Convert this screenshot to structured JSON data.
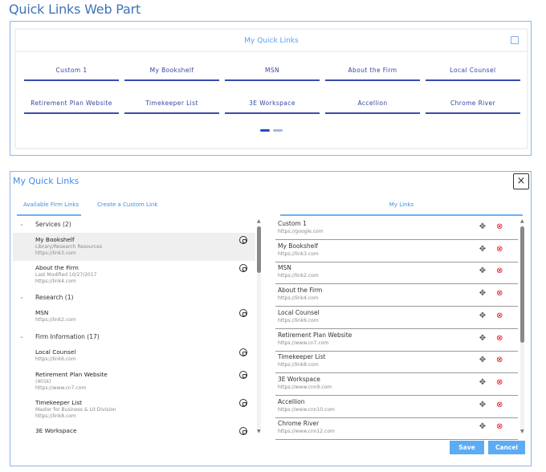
{
  "page_title": "Quick Links Web Part",
  "webpart": {
    "header": "My Quick Links",
    "tiles": [
      "Custom 1",
      "My Bookshelf",
      "MSN",
      "About the Firm",
      "Local Counsel",
      "Retirement Plan Website",
      "Timekeeper List",
      "3E Workspace",
      "Accellion",
      "Chrome River"
    ],
    "current_page": 1,
    "page_count": 2
  },
  "dialog": {
    "title": "My Quick Links",
    "close": "×",
    "tabs": [
      "Available Firm Links",
      "Create a Custom Link"
    ],
    "groups": [
      {
        "label": "Services (2)",
        "items": [
          {
            "name": "My Bookshelf",
            "desc": "Library/Research Resources",
            "url": "https://link3.com"
          },
          {
            "name": "About the Firm",
            "desc": "Last Modified 10/27/2017",
            "url": "https://link4.com"
          }
        ]
      },
      {
        "label": "Research (1)",
        "items": [
          {
            "name": "MSN",
            "url": "https://link2.com"
          }
        ]
      },
      {
        "label": "Firm Information (17)",
        "items": [
          {
            "name": "Local Counsel",
            "url": "https://link6.com"
          },
          {
            "name": "Retirement Plan Website",
            "desc": "(401k)",
            "url": "https://www.cn7.com"
          },
          {
            "name": "Timekeeper List",
            "desc": "Master for Business & Lit Division",
            "url": "https://link8.com"
          },
          {
            "name": "3E Workspace",
            "url": "https://www.cnn9.com"
          }
        ]
      }
    ],
    "my_links_header": "My Links",
    "my_links": [
      {
        "name": "Custom 1",
        "url": "https://google.com"
      },
      {
        "name": "My Bookshelf",
        "url": "https://link3.com"
      },
      {
        "name": "MSN",
        "url": "https://link2.com"
      },
      {
        "name": "About the Firm",
        "url": "https://link4.com"
      },
      {
        "name": "Local Counsel",
        "url": "https://link6.com"
      },
      {
        "name": "Retirement Plan Website",
        "url": "https://www.cn7.com"
      },
      {
        "name": "Timekeeper List",
        "url": "https://link8.com"
      },
      {
        "name": "3E Workspace",
        "url": "https://www.cnn9.com"
      },
      {
        "name": "Accellion",
        "url": "https://www.cnn10.com"
      },
      {
        "name": "Chrome River",
        "url": "https://www.cnn12.com"
      }
    ],
    "save": "Save",
    "cancel": "Cancel"
  }
}
